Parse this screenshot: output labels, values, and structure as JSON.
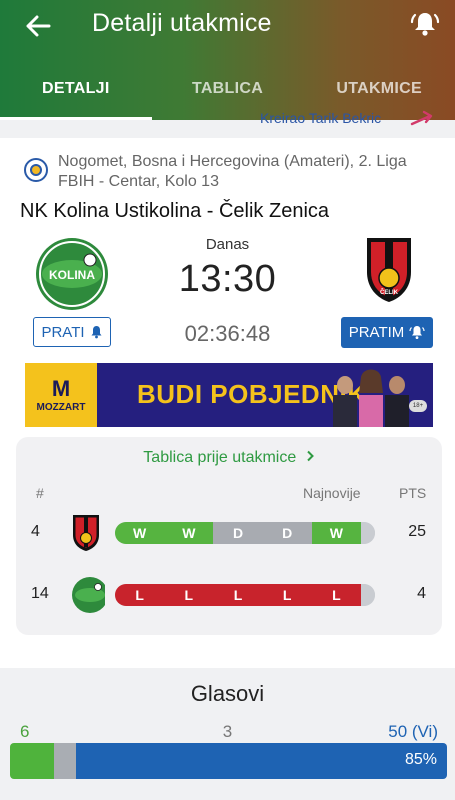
{
  "header": {
    "title": "Detalji utakmice",
    "tabs": [
      {
        "label": "DETALJI",
        "active": true
      },
      {
        "label": "TABLICA",
        "active": false
      },
      {
        "label": "UTAKMICE",
        "active": false
      }
    ],
    "peek_text": "Kreirao Tarik Bekric"
  },
  "match": {
    "league": "Nogomet, Bosna i Hercegovina (Amateri), 2. Liga FBIH - Centar, Kolo 13",
    "title": "NK Kolina Ustikolina - Čelik Zenica",
    "day": "Danas",
    "kickoff": "13:30",
    "countdown": "02:36:48",
    "home_logo_text": "KOLINA",
    "away_logo_text": "ČELIK",
    "follow_home_label": "PRATI",
    "follow_away_label": "PRATIM"
  },
  "banner": {
    "brand_mark": "M",
    "brand": "MOZZART",
    "slogan": "BUDI POBJEDNIK",
    "badge": "18+"
  },
  "standings": {
    "link_label": "Tablica prije utakmice",
    "col_rank": "#",
    "col_form": "Najnovije",
    "col_pts": "PTS",
    "rows": [
      {
        "rank": "4",
        "team": "Čelik Zenica",
        "form": [
          "W",
          "W",
          "D",
          "D",
          "W"
        ],
        "pts": "25"
      },
      {
        "rank": "14",
        "team": "NK Kolina Ustikolina",
        "form": [
          "L",
          "L",
          "L",
          "L",
          "L"
        ],
        "pts": "4"
      }
    ]
  },
  "votes": {
    "title": "Glasovi",
    "home": "6",
    "draw": "3",
    "away": "50 (Vi)",
    "away_percent": "85%",
    "home_share": 0.1,
    "draw_share": 0.05,
    "away_share": 0.85,
    "colors": {
      "home": "#4fb33c",
      "draw": "#a9adb3",
      "away": "#1e63b3"
    }
  }
}
